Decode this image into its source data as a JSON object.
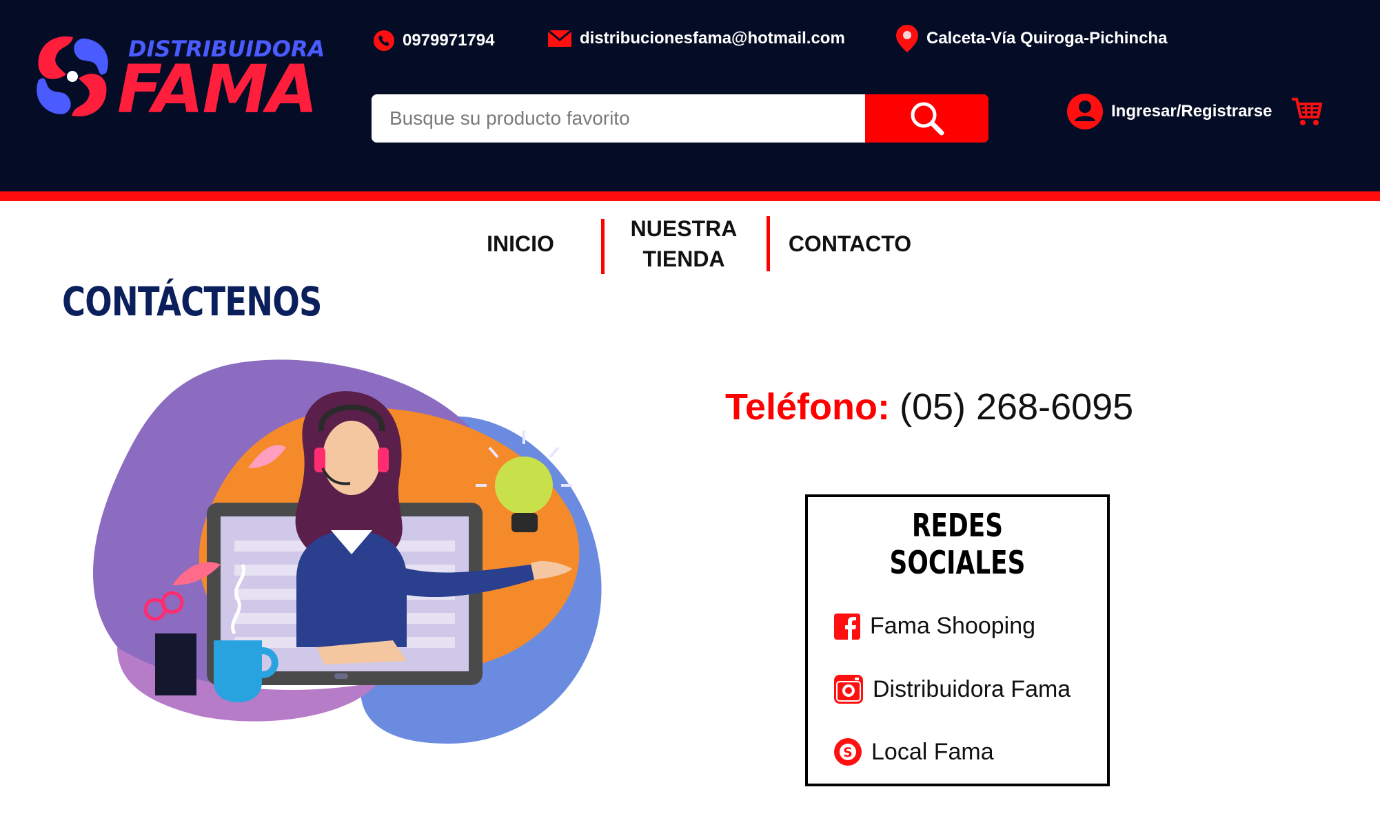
{
  "brand": {
    "top_text": "DISTRIBUIDORA",
    "main_text": "FAMA",
    "colors": {
      "header_bg": "#050d26",
      "accent_red": "#ff0d0d",
      "brand_blue": "#4a5bff",
      "title_navy": "#0b1f5c"
    }
  },
  "header": {
    "phone": {
      "icon": "phone-icon",
      "text": "0979971794"
    },
    "email": {
      "icon": "mail-icon",
      "text": "distribucionesfama@hotmail.com"
    },
    "location": {
      "icon": "map-pin-icon",
      "text": "Calceta-Vía Quiroga-Pichincha"
    },
    "search": {
      "placeholder": "Busque su producto favorito",
      "value": "",
      "button_icon": "search-icon"
    },
    "login": {
      "icon": "user-icon",
      "label": "Ingresar/Registrarse"
    },
    "cart": {
      "icon": "cart-icon"
    }
  },
  "nav": {
    "items": [
      {
        "label": "INICIO"
      },
      {
        "label_line1": "NUESTRA",
        "label_line2": "TIENDA"
      },
      {
        "label": "CONTACTO"
      }
    ]
  },
  "main": {
    "title": "CONTÁCTENOS",
    "phone_label": "Teléfono:",
    "phone_value": "(05) 268-6095",
    "illustration": "customer-support-illustration",
    "social": {
      "title": "REDES SOCIALES",
      "items": [
        {
          "icon": "facebook-icon",
          "label": "Fama Shooping"
        },
        {
          "icon": "instagram-icon",
          "label": "Distribuidora Fama"
        },
        {
          "icon": "skype-icon",
          "label": "Local Fama"
        }
      ]
    }
  }
}
